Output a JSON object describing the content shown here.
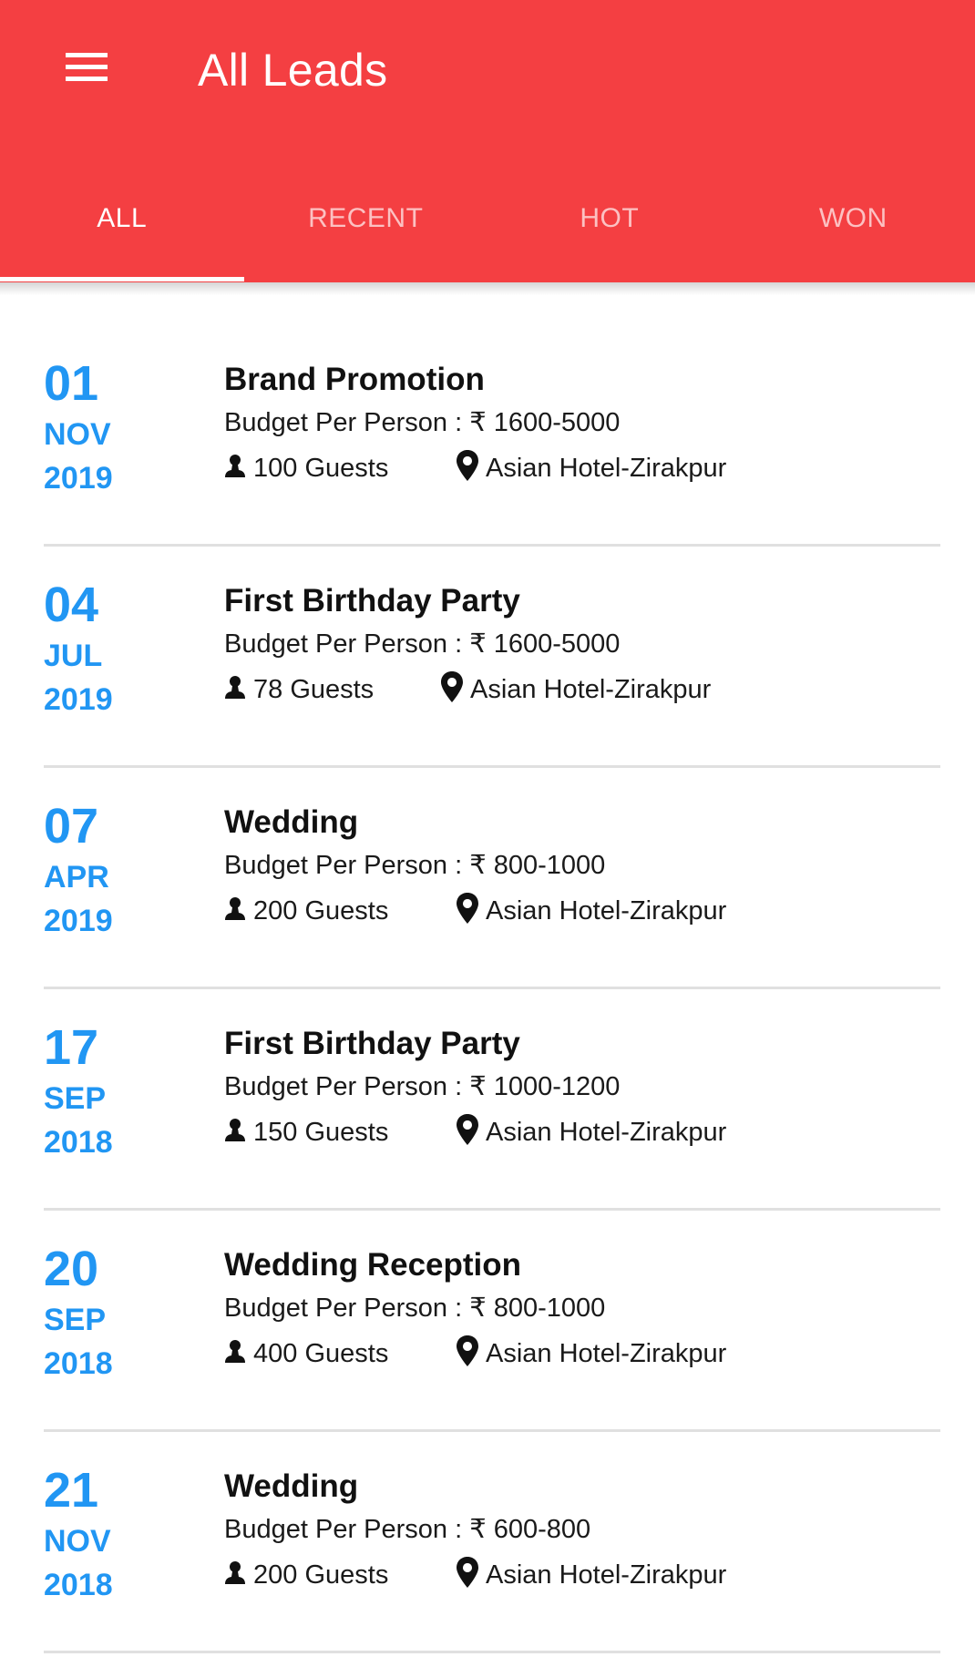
{
  "appbar": {
    "title": "All Leads",
    "menu_icon": "hamburger-menu-icon",
    "background_color": "#F43F42"
  },
  "tabs": [
    {
      "label": "ALL",
      "active": true
    },
    {
      "label": "RECENT",
      "active": false
    },
    {
      "label": "HOT",
      "active": false
    },
    {
      "label": "WON",
      "active": false
    }
  ],
  "accent_color": "#2196F3",
  "leads": [
    {
      "day": "01",
      "month": "NOV",
      "year": "2019",
      "event": "Brand Promotion",
      "budget": "Budget Per Person : ₹ 1600-5000",
      "guests": "100 Guests",
      "venue": "Asian Hotel-Zirakpur"
    },
    {
      "day": "04",
      "month": "JUL",
      "year": "2019",
      "event": "First Birthday Party",
      "budget": "Budget Per Person : ₹ 1600-5000",
      "guests": "78 Guests",
      "venue": "Asian Hotel-Zirakpur"
    },
    {
      "day": "07",
      "month": "APR",
      "year": "2019",
      "event": "Wedding",
      "budget": "Budget Per Person : ₹ 800-1000",
      "guests": "200 Guests",
      "venue": "Asian Hotel-Zirakpur"
    },
    {
      "day": "17",
      "month": "SEP",
      "year": "2018",
      "event": "First Birthday Party",
      "budget": "Budget Per Person : ₹ 1000-1200",
      "guests": "150 Guests",
      "venue": "Asian Hotel-Zirakpur"
    },
    {
      "day": "20",
      "month": "SEP",
      "year": "2018",
      "event": "Wedding Reception",
      "budget": "Budget Per Person : ₹ 800-1000",
      "guests": "400 Guests",
      "venue": "Asian Hotel-Zirakpur"
    },
    {
      "day": "21",
      "month": "NOV",
      "year": "2018",
      "event": "Wedding",
      "budget": "Budget Per Person : ₹ 600-800",
      "guests": "200 Guests",
      "venue": "Asian Hotel-Zirakpur"
    }
  ]
}
